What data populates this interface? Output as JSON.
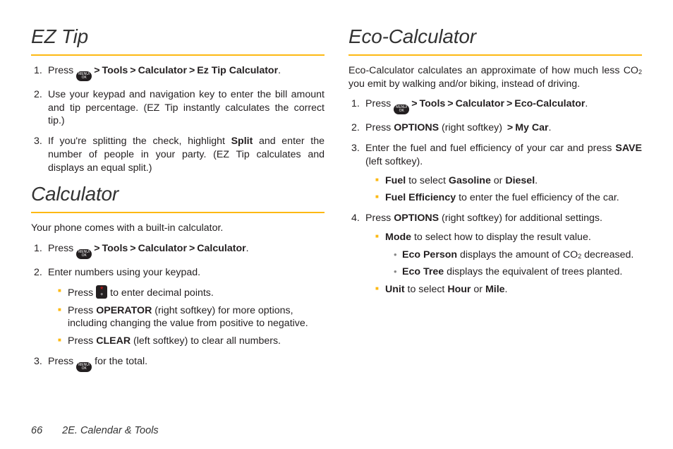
{
  "left": {
    "h_eztip": "EZ Tip",
    "eztip": {
      "s1_a": "Press ",
      "s1_path": {
        "tools": "Tools",
        "calc": "Calculator",
        "eztip": "Ez Tip Calculator"
      },
      "s2": "Use your keypad and navigation key to enter the bill amount and tip percentage. (EZ Tip instantly calculates the correct tip.)",
      "s3_a": "If you're splitting the check, highlight ",
      "s3_b": "Split",
      "s3_c": " and enter the number of people in your party. (EZ Tip calculates and displays an equal split.)"
    },
    "h_calc": "Calculator",
    "calc_lead": "Your phone comes with a built-in calculator.",
    "calc": {
      "s1_a": "Press ",
      "s1_path": {
        "tools": "Tools",
        "calc": "Calculator",
        "calc2": "Calculator"
      },
      "s2": "Enter numbers using your keypad.",
      "s2_b1_a": "Press ",
      "s2_b1_b": " to enter decimal points.",
      "s2_b2_a": "Press ",
      "s2_b2_b": "OPERATOR",
      "s2_b2_c": " (right softkey) for more options, including changing the value from positive to negative.",
      "s2_b3_a": "Press ",
      "s2_b3_b": "CLEAR",
      "s2_b3_c": " (left softkey) to clear all numbers.",
      "s3_a": "Press ",
      "s3_b": " for the total."
    }
  },
  "right": {
    "h_eco": "Eco-Calculator",
    "eco_lead_a": "Eco-Calculator calculates an approximate of how much less CO",
    "eco_lead_sub": "2",
    "eco_lead_b": " you emit by walking and/or biking, instead of driving.",
    "eco": {
      "s1_a": "Press ",
      "s1_path": {
        "tools": "Tools",
        "calc": "Calculator",
        "eco": "Eco-Calculator"
      },
      "s2_a": "Press ",
      "s2_b": "OPTIONS",
      "s2_c": " (right softkey) ",
      "s2_d": "My Car",
      "s3_a": "Enter the fuel and fuel efficiency of your car and press ",
      "s3_b": "SAVE",
      "s3_c": " (left softkey).",
      "s3_i1_a": "Fuel",
      "s3_i1_b": " to select ",
      "s3_i1_c": "Gasoline",
      "s3_i1_d": " or ",
      "s3_i1_e": "Diesel",
      "s3_i2_a": "Fuel Efficiency",
      "s3_i2_b": " to enter the fuel efficiency of the car.",
      "s4_a": "Press ",
      "s4_b": "OPTIONS",
      "s4_c": " (right softkey) for additional settings.",
      "s4_i1_a": "Mode",
      "s4_i1_b": " to select how to display the result value.",
      "s4_i1_d1_a": "Eco Person",
      "s4_i1_d1_b": " displays the amount of CO",
      "s4_i1_d1_sub": "2",
      "s4_i1_d1_c": " decreased.",
      "s4_i1_d2_a": " Eco Tree",
      "s4_i1_d2_b": " displays the equivalent of trees planted.",
      "s4_i2_a": "Unit",
      "s4_i2_b": " to select ",
      "s4_i2_c": "Hour",
      "s4_i2_d": " or ",
      "s4_i2_e": "Mile"
    }
  },
  "key_ok_top": "MENU/",
  "key_ok_bot": "OK",
  "gt": ">",
  "period": ".",
  "footer": {
    "page": "66",
    "section": "2E. Calendar & Tools"
  },
  "nums": {
    "n1": "1.",
    "n2": "2.",
    "n3": "3.",
    "n4": "4."
  }
}
